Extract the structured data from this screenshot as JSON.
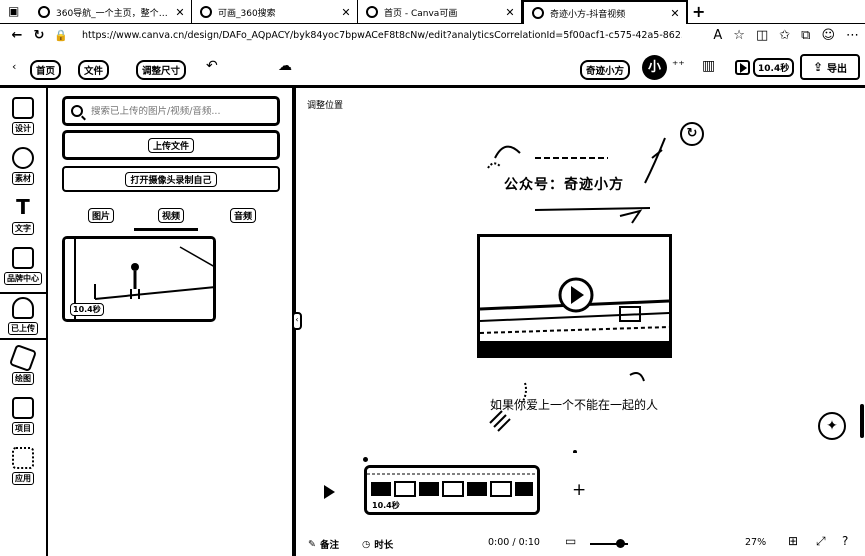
{
  "browser": {
    "tabs": [
      {
        "title": "360导航_一个主页，整个世界",
        "active": false
      },
      {
        "title": "可画_360搜索",
        "active": false
      },
      {
        "title": "首页 - Canva可画",
        "active": false
      },
      {
        "title": "奇迹小方-抖音视频",
        "active": true
      }
    ],
    "new_tab": "+",
    "url": "https://www.canva.cn/design/DAFo_AQpACY/byk84yoc7bpwACeF8t8cNw/edit?analyticsCorrelationId=5f00acf1-c575-42a5-862..."
  },
  "header": {
    "home": "首页",
    "file": "文件",
    "resize": "调整尺寸",
    "design_name": "奇迹小方",
    "avatar": "小",
    "duration": "10.4秒",
    "export": "导出"
  },
  "rail": {
    "items": [
      {
        "label": "设计"
      },
      {
        "label": "素材"
      },
      {
        "label": "文字"
      },
      {
        "label": "品牌中心"
      },
      {
        "label": "已上传"
      },
      {
        "label": "绘图"
      },
      {
        "label": "项目"
      },
      {
        "label": "应用"
      }
    ]
  },
  "panel": {
    "search_placeholder": "搜索已上传的图片/视频/音频...",
    "upload_button": "上传文件",
    "record_button": "打开摄像头录制自己",
    "media_tabs": [
      "图片",
      "视频",
      "音频"
    ],
    "active_tab": "视频",
    "thumbnail_duration": "10.4秒"
  },
  "canvas": {
    "adjust_position": "调整位置",
    "headline": "公众号：奇迹小方",
    "caption": "如果你爱上一个不能在一起的人"
  },
  "timeline": {
    "clip_duration": "10.4秒"
  },
  "bottom": {
    "notes": "备注",
    "duration": "时长",
    "time": "0:00 / 0:10",
    "zoom": "27%",
    "zoom_level": 0.78
  }
}
